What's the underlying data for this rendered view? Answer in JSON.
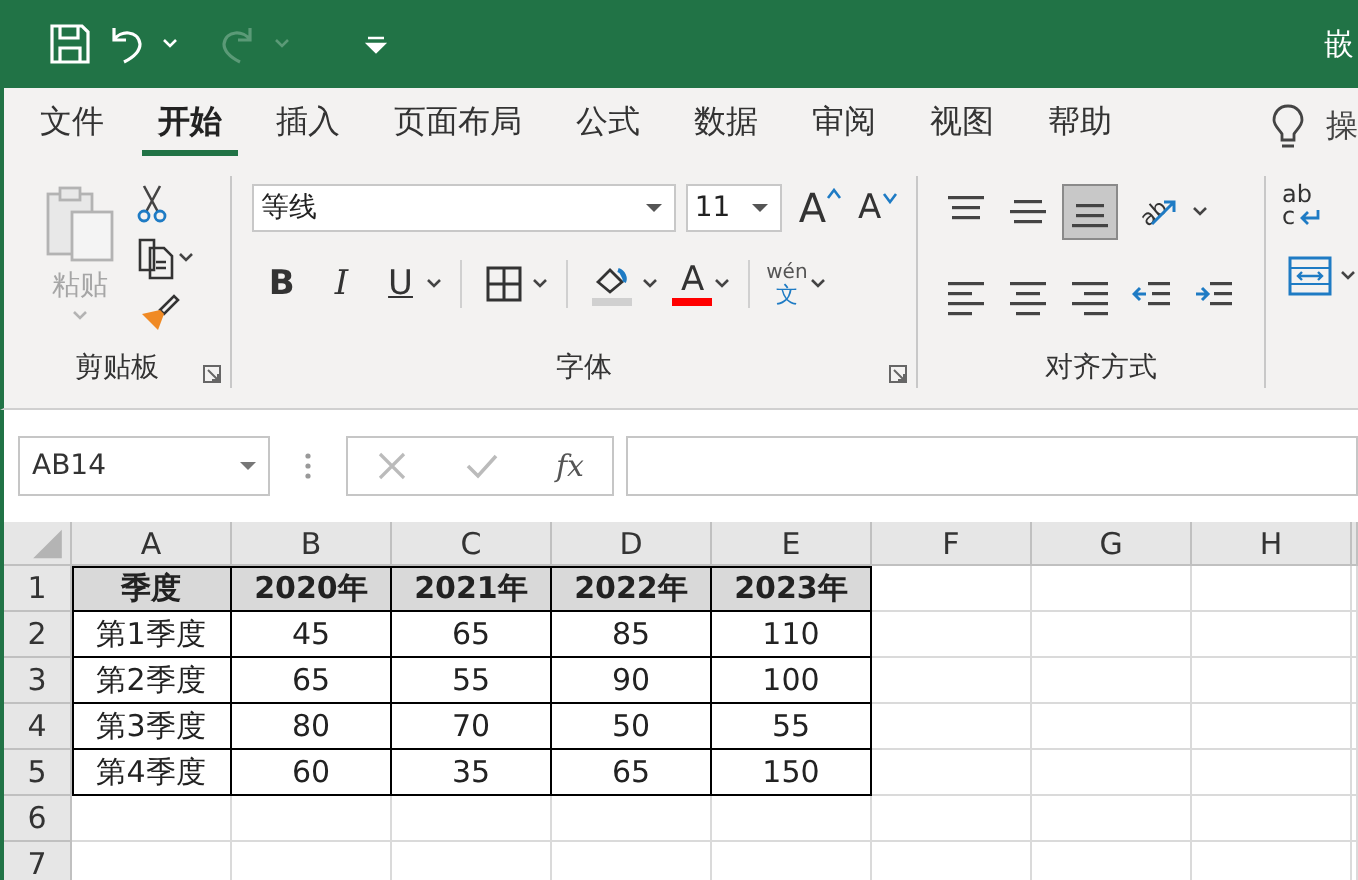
{
  "title_bar": {
    "quick_access": [
      {
        "kind": "save",
        "disabled": false
      },
      {
        "kind": "undo",
        "disabled": false
      },
      {
        "kind": "redo",
        "disabled": true
      },
      {
        "kind": "customize",
        "disabled": false
      }
    ],
    "title": "嵌"
  },
  "tabs": [
    {
      "label": "文件",
      "selected": false
    },
    {
      "label": "开始",
      "selected": true
    },
    {
      "label": "插入",
      "selected": false
    },
    {
      "label": "页面布局",
      "selected": false
    },
    {
      "label": "公式",
      "selected": false
    },
    {
      "label": "数据",
      "selected": false
    },
    {
      "label": "审阅",
      "selected": false
    },
    {
      "label": "视图",
      "selected": false
    },
    {
      "label": "帮助",
      "selected": false
    }
  ],
  "tell_me": {
    "label": "操"
  },
  "ribbon": {
    "clipboard": {
      "paste_label": "粘贴",
      "paste_disabled": true,
      "group_label": "剪贴板"
    },
    "font": {
      "font_name": "等线",
      "font_size": "11",
      "grow_label": "A",
      "shrink_label": "A",
      "bold_label": "B",
      "italic_label": "I",
      "underline_label": "U",
      "font_color_label": "A",
      "phonetic_label": "wén",
      "phonetic_char": "文",
      "group_label": "字体"
    },
    "alignment": {
      "top_row": [
        {
          "kind": "top",
          "selected": false
        },
        {
          "kind": "middle",
          "selected": false
        },
        {
          "kind": "bottom",
          "selected": true
        },
        {
          "kind": "orientation",
          "selected": false,
          "label": "ab"
        }
      ],
      "bottom_row": [
        {
          "kind": "left",
          "selected": false
        },
        {
          "kind": "center",
          "selected": false
        },
        {
          "kind": "right",
          "selected": false
        },
        {
          "kind": "outdent",
          "selected": false
        },
        {
          "kind": "indent",
          "selected": false
        }
      ],
      "group_label": "对齐方式"
    },
    "wrap": {
      "top_text": "ab",
      "bottom_text": "c"
    }
  },
  "formula_bar": {
    "name_box": "AB14",
    "fx_label": "fx"
  },
  "sheet": {
    "columns": [
      "A",
      "B",
      "C",
      "D",
      "E",
      "F",
      "G",
      "H"
    ],
    "rows": [
      {
        "number": "1",
        "kind": "header",
        "cells": [
          "季度",
          "2020年",
          "2021年",
          "2022年",
          "2023年"
        ]
      },
      {
        "number": "2",
        "kind": "data",
        "cells": [
          "第1季度",
          "45",
          "65",
          "85",
          "110"
        ]
      },
      {
        "number": "3",
        "kind": "data",
        "cells": [
          "第2季度",
          "65",
          "55",
          "90",
          "100"
        ]
      },
      {
        "number": "4",
        "kind": "data",
        "cells": [
          "第3季度",
          "80",
          "70",
          "50",
          "55"
        ]
      },
      {
        "number": "5",
        "kind": "data",
        "cells": [
          "第4季度",
          "60",
          "35",
          "65",
          "150"
        ]
      },
      {
        "number": "6",
        "kind": "empty"
      },
      {
        "number": "7",
        "kind": "empty"
      }
    ]
  }
}
